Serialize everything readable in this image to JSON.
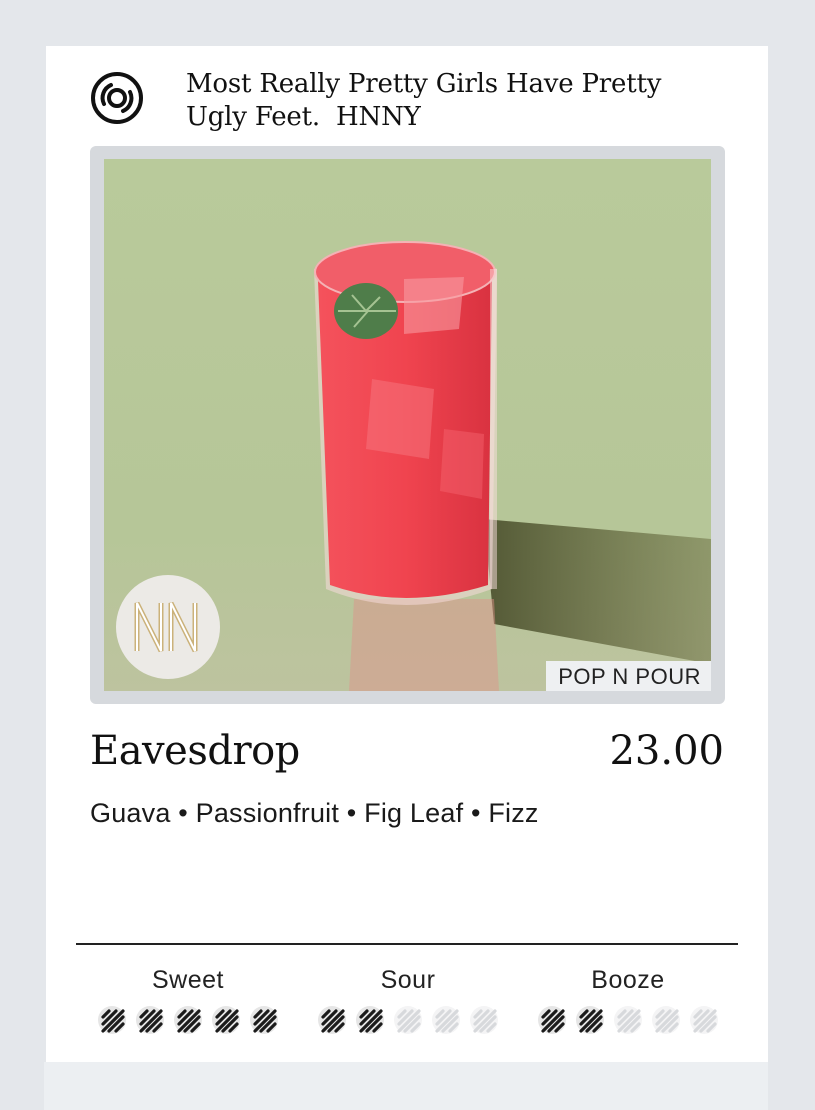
{
  "header": {
    "icon": "vinyl-record-icon",
    "song_line1": "Most Really Pretty Girls Have Pretty",
    "song_line2": "Ugly Feet.  HNNY"
  },
  "photo": {
    "logo": "NN",
    "tag": "POP N POUR"
  },
  "drink": {
    "name": "Eavesdrop",
    "price": "23.00",
    "ingredients": "Guava • Passionfruit • Fig Leaf • Fizz"
  },
  "scales": [
    {
      "label": "Sweet",
      "level": 5,
      "max": 5
    },
    {
      "label": "Sour",
      "level": 2,
      "max": 5
    },
    {
      "label": "Booze",
      "level": 2,
      "max": 5
    }
  ],
  "colors": {
    "filled": "#1b1b1b",
    "empty": "#d7d9dc",
    "drink": "#ee3f4a",
    "background": "#b8c99a"
  }
}
